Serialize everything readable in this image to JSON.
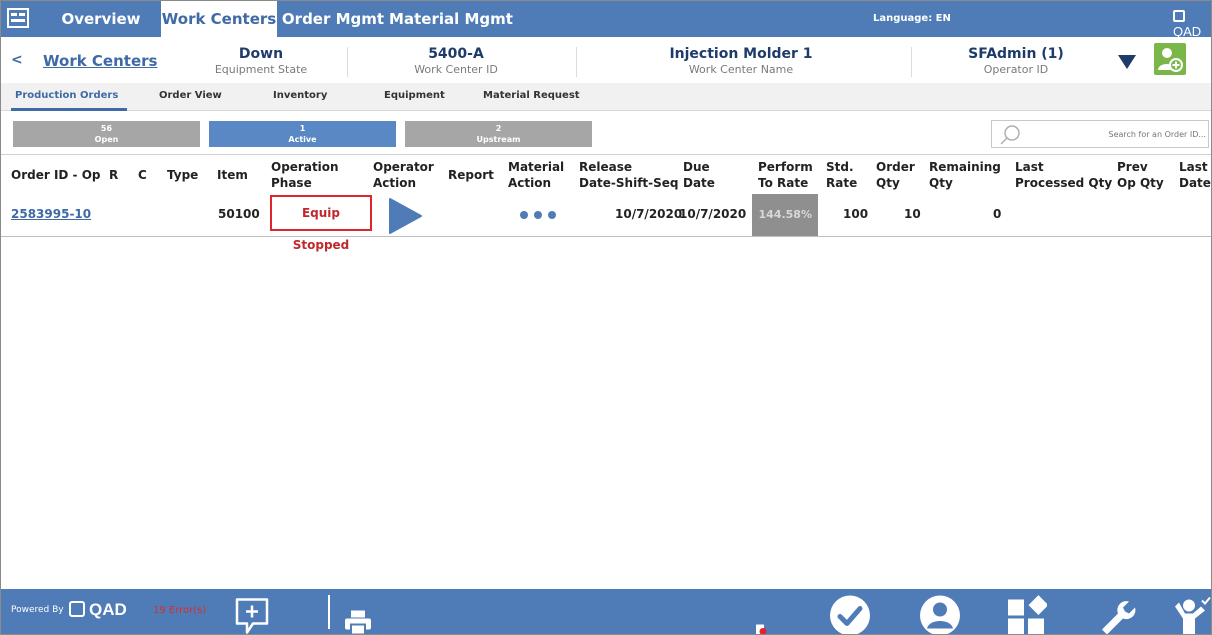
{
  "nav": {
    "tabs": [
      {
        "label": "Overview"
      },
      {
        "label": "Work Centers",
        "active": true
      },
      {
        "label": "Order Mgmt"
      },
      {
        "label": "Material Mgmt"
      }
    ],
    "language_label": "Language:  EN",
    "logo_text": "QAD"
  },
  "header": {
    "back_label": "<",
    "work_centers_link": "Work Centers",
    "equipment_state": {
      "value": "Down",
      "label": "Equipment State"
    },
    "work_center_id": {
      "value": "5400-A",
      "label": "Work Center ID"
    },
    "work_center_name": {
      "value": "Injection Molder 1",
      "label": "Work Center Name"
    },
    "operator_id": {
      "value": "SFAdmin (1)",
      "label": "Operator ID"
    }
  },
  "subtabs": [
    {
      "label": "Production Orders",
      "active": true
    },
    {
      "label": "Order View"
    },
    {
      "label": "Inventory"
    },
    {
      "label": "Equipment"
    },
    {
      "label": "Material Request"
    }
  ],
  "filters": [
    {
      "count": "56",
      "label": "Open"
    },
    {
      "count": "1",
      "label": "Active",
      "active": true
    },
    {
      "count": "2",
      "label": "Upstream"
    }
  ],
  "search": {
    "placeholder": "Search for an Order ID..."
  },
  "table": {
    "columns": [
      "Order ID - Op",
      "R",
      "C",
      "Type",
      "Item",
      "Operation\nPhase",
      "Operator\nAction",
      "Report",
      "Material\nAction",
      "Release\nDate-Shift-Seq",
      "Due\nDate",
      "Perform\nTo Rate",
      "Std.\nRate",
      "Order\nQty",
      "Remaining\nQty",
      "Last\nProcessed Qty",
      "Prev\nOp Qty",
      "Last\nDate"
    ],
    "rows": [
      {
        "order_id": "2583995-10",
        "item": "50100",
        "phase": "Equip Stopped",
        "release_date": "10/7/2020",
        "due_date": "10/7/2020",
        "perform_to_rate": "144.58%",
        "std_rate": "100",
        "order_qty": "10",
        "remaining_qty": "0"
      }
    ]
  },
  "footer": {
    "powered_by": "Powered By",
    "logo_text": "QAD",
    "errors": "19 Error(s)"
  },
  "colors": {
    "primary": "#4f7cb6",
    "accent_green": "#7ab648",
    "error_red": "#e0242b"
  }
}
